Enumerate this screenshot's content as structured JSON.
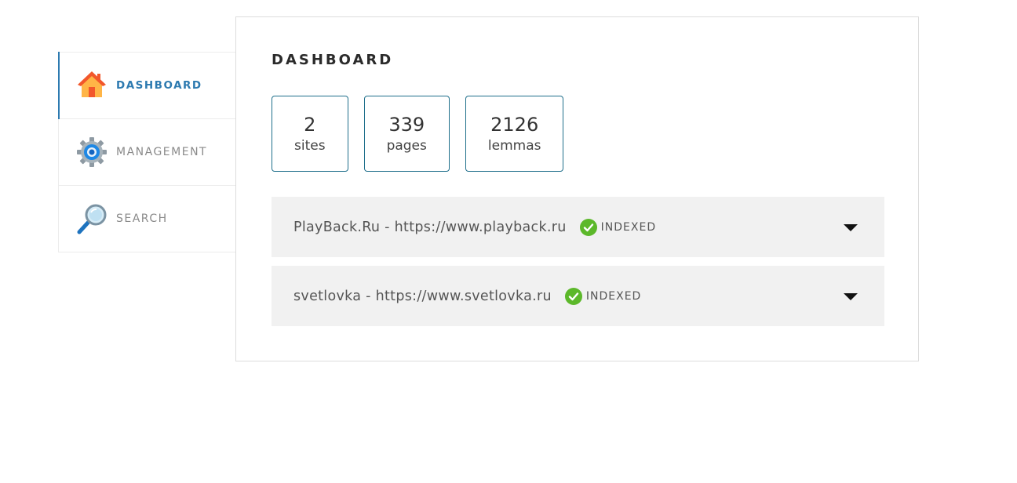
{
  "sidebar": {
    "items": [
      {
        "label": "DASHBOARD",
        "icon": "house-icon",
        "active": true
      },
      {
        "label": "MANAGEMENT",
        "icon": "gear-icon",
        "active": false
      },
      {
        "label": "SEARCH",
        "icon": "magnifier-icon",
        "active": false
      }
    ]
  },
  "main": {
    "title": "DASHBOARD",
    "stats": [
      {
        "value": "2",
        "label": "sites"
      },
      {
        "value": "339",
        "label": "pages"
      },
      {
        "value": "2126",
        "label": "lemmas"
      }
    ],
    "sites": [
      {
        "name": "PlayBack.Ru - https://www.playback.ru",
        "status": "INDEXED"
      },
      {
        "name": "svetlovka - https://www.svetlovka.ru",
        "status": "INDEXED"
      }
    ]
  },
  "colors": {
    "accent": "#2d7ab0",
    "stat_border": "#1f6f8b",
    "status_green": "#5cb82a",
    "row_bg": "#f1f1f1"
  }
}
